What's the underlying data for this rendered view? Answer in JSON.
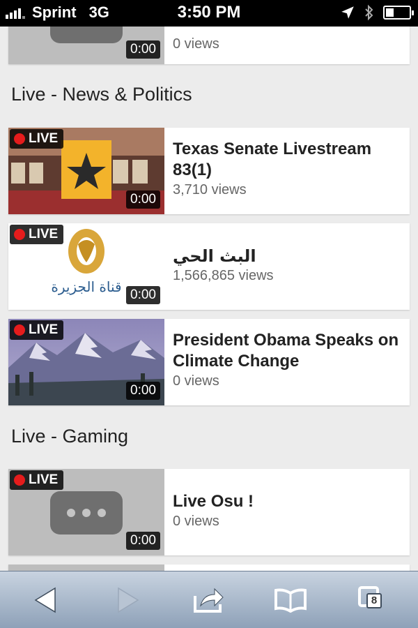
{
  "status_bar": {
    "carrier": "Sprint",
    "network": "3G",
    "time": "3:50 PM",
    "battery_level": 0.35
  },
  "top_partial_card": {
    "duration": "0:00",
    "views": "0 views"
  },
  "sections": [
    {
      "title": "Live - News & Politics",
      "videos": [
        {
          "badge": "LIVE",
          "title": "Texas Senate Livestream 83(1)",
          "views": "3,710 views",
          "duration": "0:00"
        },
        {
          "badge": "LIVE",
          "title": "البث الحي",
          "views": "1,566,865 views",
          "duration": "0:00"
        },
        {
          "badge": "LIVE",
          "title": "President Obama Speaks on Climate Change",
          "views": "0 views",
          "duration": "0:00"
        }
      ]
    },
    {
      "title": "Live - Gaming",
      "videos": [
        {
          "badge": "LIVE",
          "title": "Live Osu !",
          "views": "0 views",
          "duration": "0:00"
        }
      ]
    }
  ],
  "aljazeera_logo_text": "قناة الجزيرة",
  "toolbar": {
    "tab_count": "8",
    "icons": [
      "back-icon",
      "forward-icon",
      "share-icon",
      "bookmarks-icon",
      "tabs-icon"
    ]
  },
  "colors": {
    "live_dot": "#e51c1c",
    "toolbar": "#a9b8ca",
    "card_background": "#ffffff",
    "page_background": "#ececec"
  }
}
